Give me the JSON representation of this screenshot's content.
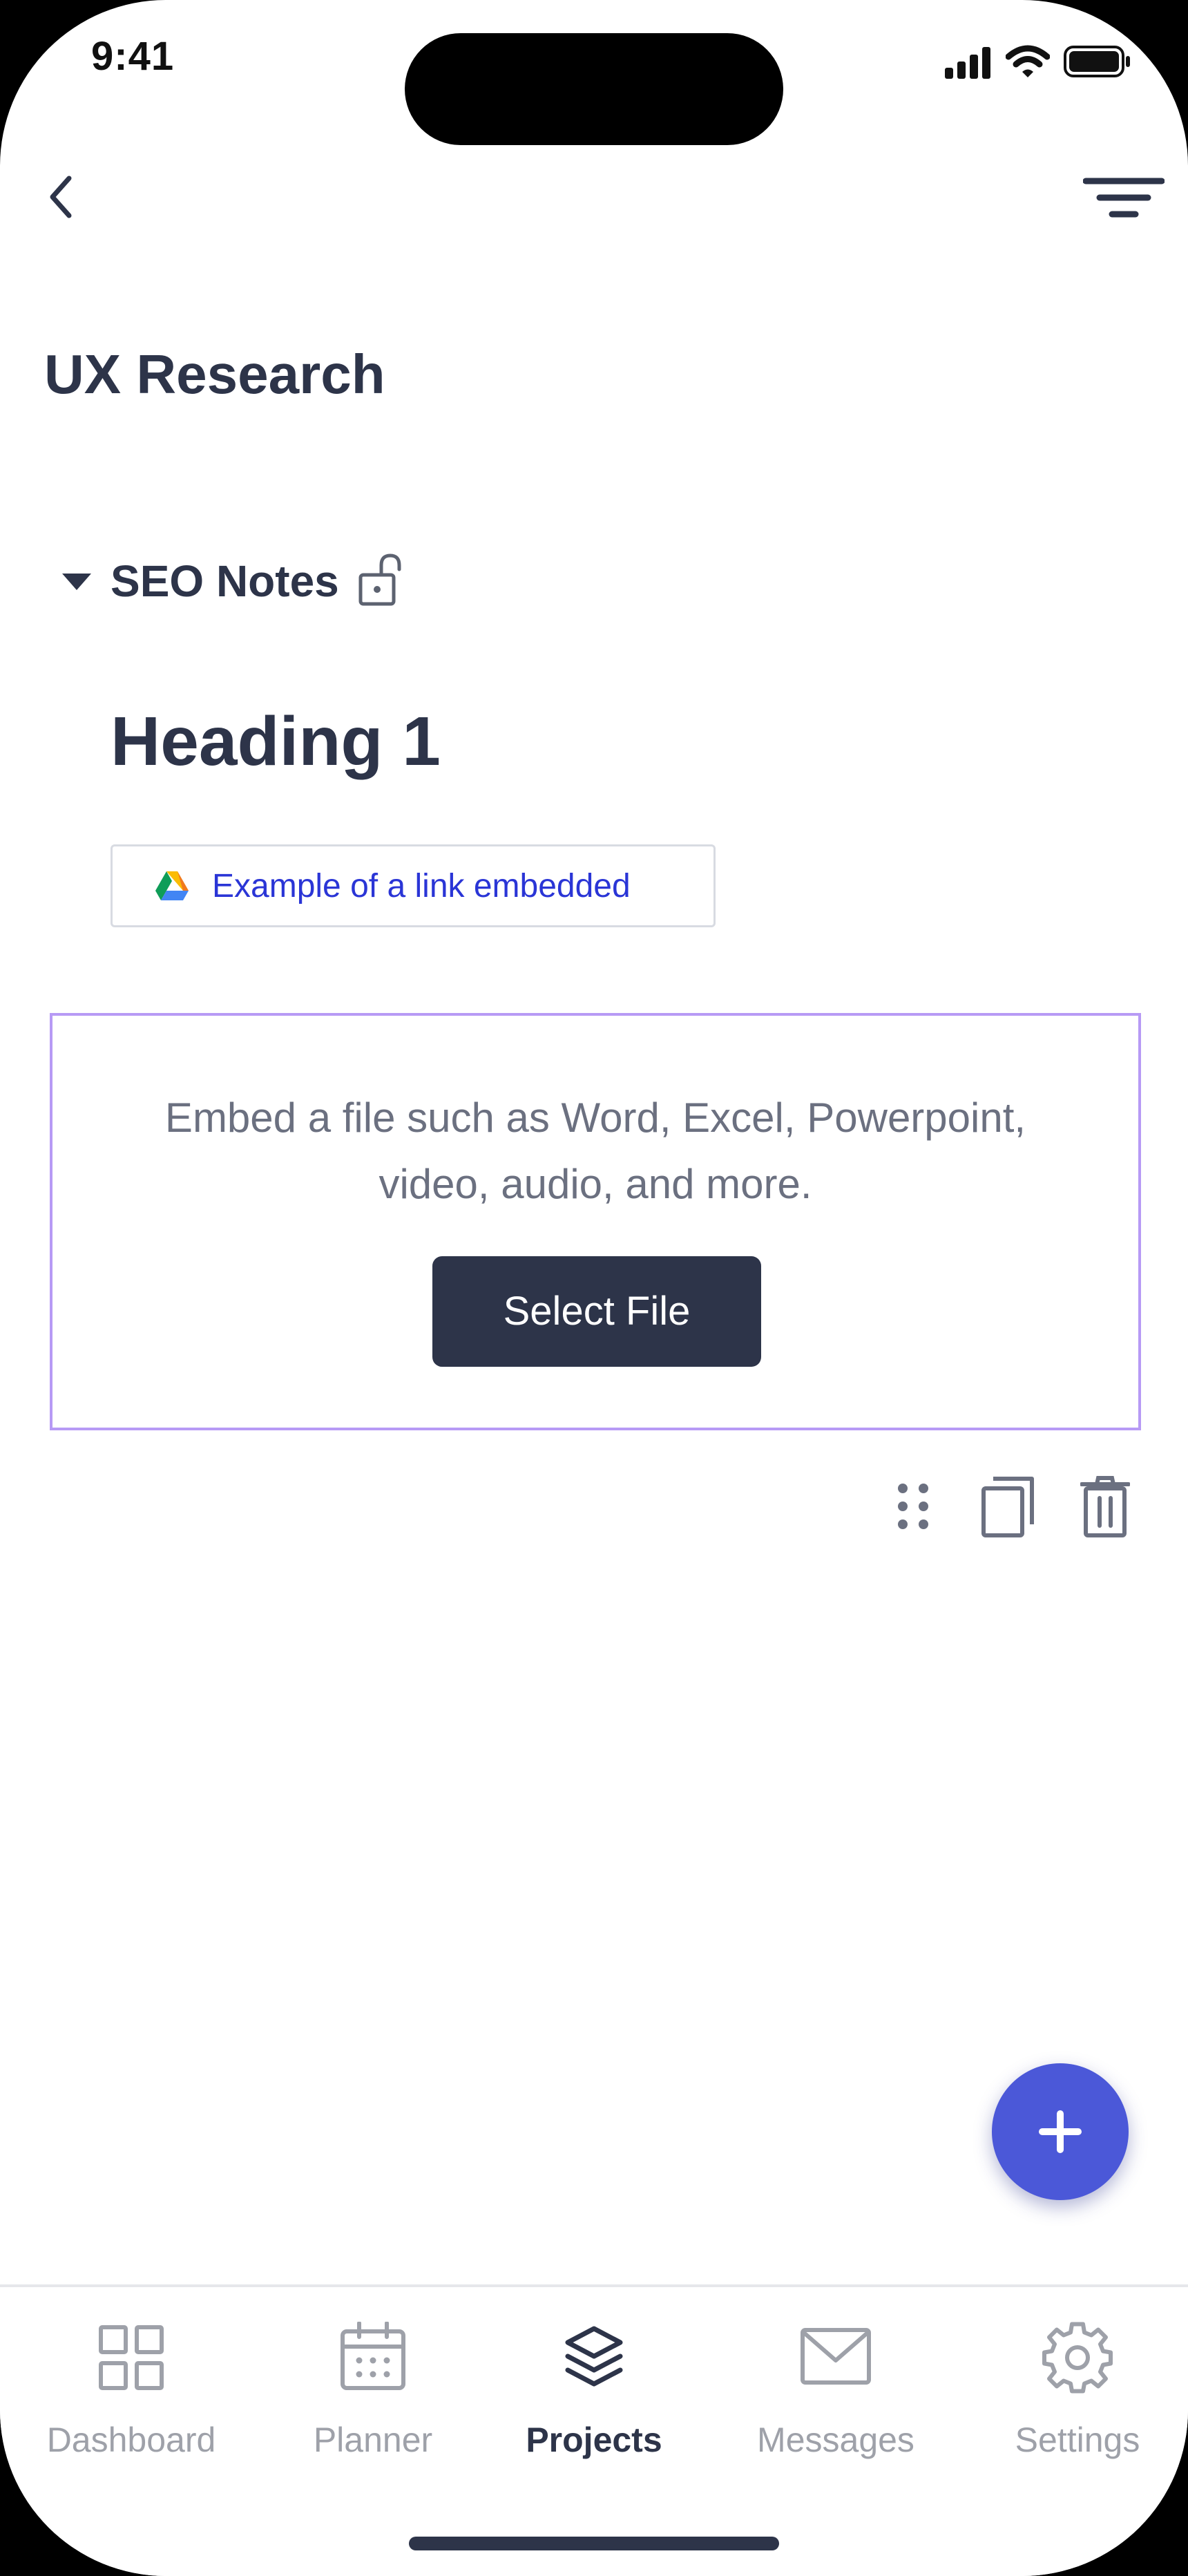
{
  "status_bar": {
    "time": "9:41"
  },
  "header": {
    "back_icon": "chevron-left-icon",
    "filter_icon": "filter-lines-icon"
  },
  "page": {
    "title": "UX Research"
  },
  "section": {
    "label": "SEO Notes",
    "collapse_icon": "caret-down-icon",
    "lock_icon": "unlocked-padlock-icon"
  },
  "content": {
    "heading": "Heading 1",
    "link": {
      "icon": "google-drive-icon",
      "text": "Example of a link embedded"
    },
    "embed": {
      "line1": "Embed a file such as Word, Excel, Powerpoint,",
      "line2": "video, audio, and more.",
      "button_label": "Select File"
    },
    "block_actions": [
      "drag-handle-icon",
      "copy-icon",
      "trash-icon"
    ]
  },
  "fab": {
    "icon": "plus-icon"
  },
  "tabs": [
    {
      "label": "Dashboard",
      "icon": "grid-icon",
      "active": false
    },
    {
      "label": "Planner",
      "icon": "calendar-icon",
      "active": false
    },
    {
      "label": "Projects",
      "icon": "layers-icon",
      "active": true
    },
    {
      "label": "Messages",
      "icon": "mail-icon",
      "active": false
    },
    {
      "label": "Settings",
      "icon": "gear-icon",
      "active": false
    }
  ],
  "colors": {
    "primary_text": "#2d3449",
    "link": "#2a35d6",
    "embed_border": "#b79af5",
    "fab": "#4b58d8",
    "inactive_tab": "#9ea1a9"
  }
}
